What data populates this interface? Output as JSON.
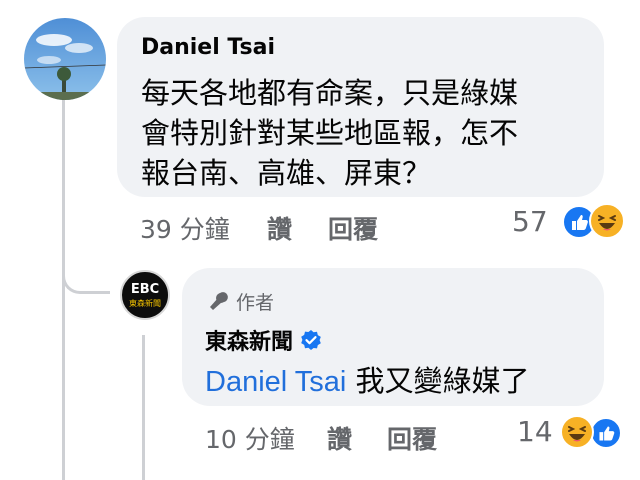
{
  "comment": {
    "author": "Daniel Tsai",
    "text": "每天各地都有命案，只是綠媒會特別針對某些地區報，怎不報台南、高雄、屏東？",
    "text_lines": [
      "每天各地都有命案，只是綠媒",
      "會特別針對某些地區報，怎不",
      "報台南、高雄、屏東？"
    ],
    "time": "39 分鐘",
    "like_label": "讚",
    "reply_label": "回覆",
    "reaction_count": "57",
    "reactions": [
      "like-icon",
      "haha-icon"
    ]
  },
  "reply": {
    "avatar_text": "EBC",
    "avatar_sub": "東森新聞",
    "badge": "作者",
    "author": "東森新聞",
    "verified": true,
    "mention": "Daniel Tsai",
    "text": "我又變綠媒了",
    "time": "10 分鐘",
    "like_label": "讚",
    "reply_label": "回覆",
    "reaction_count": "14",
    "reactions": [
      "haha-icon",
      "like-icon"
    ]
  },
  "colors": {
    "bubble": "#f0f2f5",
    "mention": "#216fdb",
    "meta": "#65676b",
    "like_blue": "#1877f2",
    "haha_yellow": "#f7b125",
    "thread_line": "#ced0d4"
  }
}
